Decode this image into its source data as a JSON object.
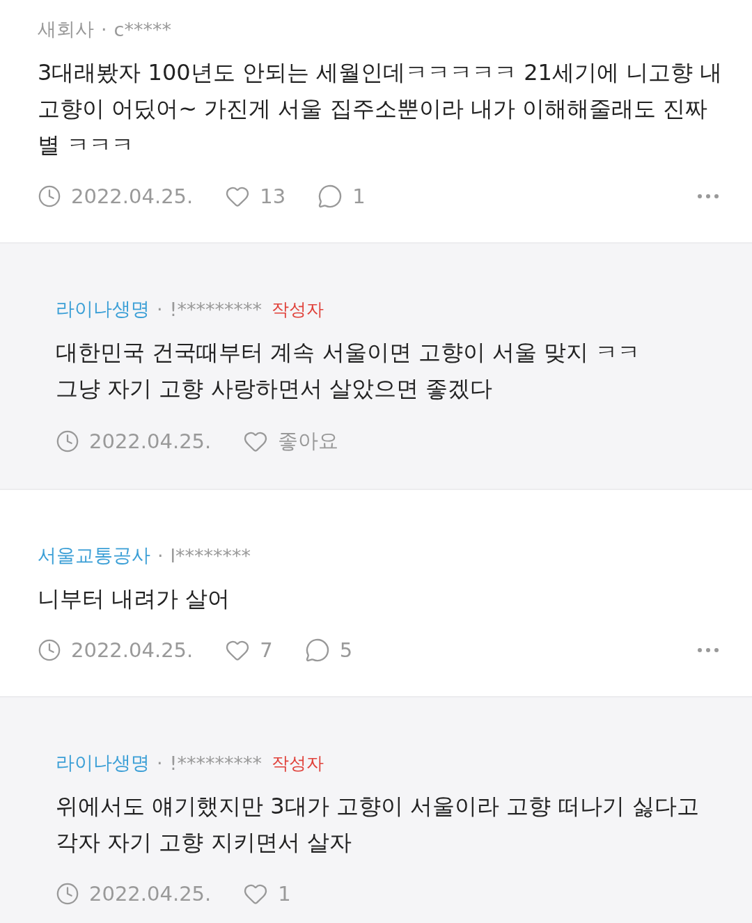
{
  "comments": [
    {
      "kind": "comment",
      "company": "새회사",
      "company_linked": false,
      "separator": "·",
      "nickname": "c*****",
      "text": "3대래봤자 100년도 안되는 세월인데ㅋㅋㅋㅋㅋ 21세기에 니고향 내\n고향이 어딨어~ 가진게 서울 집주소뿐이라 내가 이해해줄래도 진짜\n별 ㅋㅋㅋ",
      "date": "2022.04.25.",
      "likes": "13",
      "replies": "1",
      "has_more": true
    },
    {
      "kind": "reply",
      "company": "라이나생명",
      "company_linked": true,
      "separator": "·",
      "nickname": "!*********",
      "author_badge": "작성자",
      "text": "대한민국 건국때부터 계속 서울이면 고향이 서울 맞지 ㅋㅋ\n그냥 자기 고향 사랑하면서 살았으면 좋겠다",
      "date": "2022.04.25.",
      "likes": "좋아요",
      "has_more": false
    },
    {
      "kind": "comment",
      "company": "서울교통공사",
      "company_linked": true,
      "separator": "·",
      "nickname": "l********",
      "text": "니부터 내려가 살어",
      "date": "2022.04.25.",
      "likes": "7",
      "replies": "5",
      "has_more": true
    },
    {
      "kind": "reply",
      "company": "라이나생명",
      "company_linked": true,
      "separator": "·",
      "nickname": "!*********",
      "author_badge": "작성자",
      "text": "위에서도 얘기했지만 3대가 고향이 서울이라 고향 떠나기 싫다고\n각자 자기 고향 지키면서 살자",
      "date": "2022.04.25.",
      "likes": "1",
      "has_more": false
    }
  ]
}
